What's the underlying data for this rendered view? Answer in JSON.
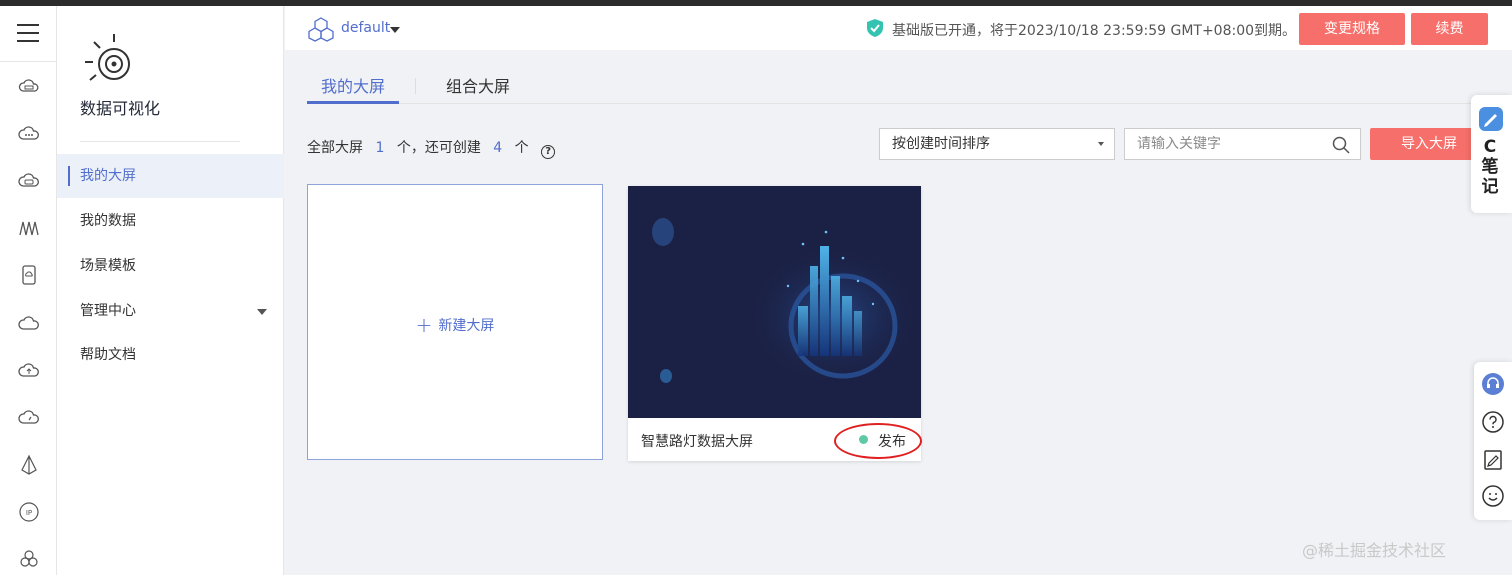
{
  "rail": {
    "icons": [
      "menu-icon",
      "cloud-server-icon",
      "cloud-dots-icon",
      "cloud-storage-icon",
      "wave-icon",
      "cloud-phone-icon",
      "cloud-icon",
      "cloud-upload-icon",
      "cloud-speed-icon",
      "pyramid-icon",
      "ip-icon",
      "flower-icon"
    ]
  },
  "sidebar": {
    "product_name": "数据可视化",
    "items": [
      {
        "label": "我的大屏",
        "active": true
      },
      {
        "label": "我的数据",
        "active": false
      },
      {
        "label": "场景模板",
        "active": false
      },
      {
        "label": "管理中心",
        "active": false
      },
      {
        "label": "帮助文档",
        "active": false
      }
    ]
  },
  "header": {
    "project": "default",
    "notice": "基础版已开通，将于2023/10/18 23:59:59 GMT+08:00到期。",
    "change_spec_label": "变更规格",
    "renew_label": "续费"
  },
  "tabs": [
    {
      "label": "我的大屏",
      "active": true
    },
    {
      "label": "组合大屏",
      "active": false
    }
  ],
  "summary": {
    "prefix": "全部大屏",
    "total": "1",
    "middle": "个，还可创建",
    "remaining": "4",
    "suffix": "个"
  },
  "toolbar": {
    "sort_value": "按创建时间排序",
    "search_placeholder": "请输入关键字",
    "import_label": "导入大屏"
  },
  "new_card": {
    "label": "新建大屏"
  },
  "screens": [
    {
      "title": "智慧路灯数据大屏",
      "status": "发布",
      "status_color": "#5dc9a6"
    }
  ],
  "note_widget": {
    "label_c": "C",
    "label_1": "笔",
    "label_2": "记"
  },
  "colors": {
    "accent": "#526ecc",
    "danger_button": "#f66f6a",
    "highlight_oval": "#e02020"
  },
  "watermark": "@稀土掘金技术社区"
}
